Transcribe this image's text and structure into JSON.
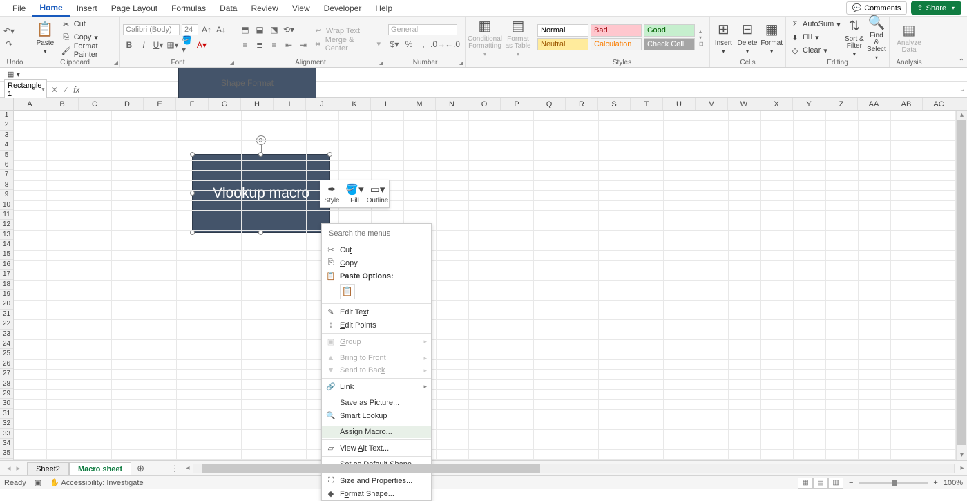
{
  "menubar": {
    "items": [
      "File",
      "Home",
      "Insert",
      "Page Layout",
      "Formulas",
      "Data",
      "Review",
      "View",
      "Developer",
      "Help",
      "Shape Format"
    ],
    "active_index": 1,
    "comments": "Comments",
    "share": "Share"
  },
  "ribbon": {
    "undo_label": "Undo",
    "clipboard": {
      "paste": "Paste",
      "cut": "Cut",
      "copy": "Copy",
      "format_painter": "Format Painter",
      "label": "Clipboard"
    },
    "font": {
      "name": "Calibri (Body)",
      "size": "24",
      "label": "Font"
    },
    "alignment": {
      "wrap": "Wrap Text",
      "merge": "Merge & Center",
      "label": "Alignment"
    },
    "number": {
      "format": "General",
      "label": "Number"
    },
    "cond_fmt": "Conditional Formatting",
    "fmt_table": "Format as Table",
    "styles": {
      "normal": "Normal",
      "bad": "Bad",
      "good": "Good",
      "neutral": "Neutral",
      "calc": "Calculation",
      "check": "Check Cell",
      "label": "Styles"
    },
    "cells": {
      "insert": "Insert",
      "delete": "Delete",
      "format": "Format",
      "label": "Cells"
    },
    "editing": {
      "autosum": "AutoSum",
      "fill": "Fill",
      "clear": "Clear",
      "sort": "Sort & Filter",
      "find": "Find & Select",
      "label": "Editing"
    },
    "analysis": {
      "analyze": "Analyze Data",
      "label": "Analysis"
    }
  },
  "formula_bar": {
    "name_box": "Rectangle 1",
    "fx": "fx",
    "value": ""
  },
  "columns": [
    "A",
    "B",
    "C",
    "D",
    "E",
    "F",
    "G",
    "H",
    "I",
    "J",
    "K",
    "L",
    "M",
    "N",
    "O",
    "P",
    "Q",
    "R",
    "S",
    "T",
    "U",
    "V",
    "W",
    "X",
    "Y",
    "Z",
    "AA",
    "AB",
    "AC"
  ],
  "row_count": 35,
  "shape": {
    "text": "Vlookup macro"
  },
  "mini_toolbar": {
    "style": "Style",
    "fill": "Fill",
    "outline": "Outline"
  },
  "context_menu": {
    "search_placeholder": "Search the menus",
    "cut": "Cut",
    "copy": "Copy",
    "paste_options": "Paste Options:",
    "edit_text": "Edit Text",
    "edit_points": "Edit Points",
    "group": "Group",
    "bring_front": "Bring to Front",
    "send_back": "Send to Back",
    "link": "Link",
    "save_picture": "Save as Picture...",
    "smart_lookup": "Smart Lookup",
    "assign_macro": "Assign Macro...",
    "view_alt": "View Alt Text...",
    "set_default": "Set as Default Shape",
    "size_props": "Size and Properties...",
    "format_shape": "Format Shape..."
  },
  "sheets": {
    "tabs": [
      "Sheet2",
      "Macro sheet"
    ],
    "active_index": 1
  },
  "status_bar": {
    "ready": "Ready",
    "accessibility": "Accessibility: Investigate",
    "zoom": "100%"
  }
}
